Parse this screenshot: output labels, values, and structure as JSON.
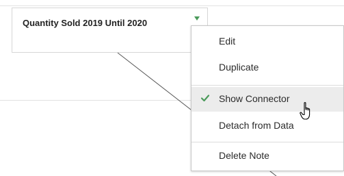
{
  "note": {
    "text": "Quantity Sold 2019 Until 2020",
    "caret_icon": "dropdown-caret-icon",
    "caret_color": "#4a9a5a"
  },
  "context_menu": {
    "items": [
      {
        "label": "Edit"
      },
      {
        "label": "Duplicate"
      },
      {
        "label": "Show Connector",
        "checked": true,
        "hovered": true
      },
      {
        "label": "Detach from Data"
      },
      {
        "label": "Delete Note"
      }
    ],
    "check_icon": "checkmark-icon",
    "check_color": "#4a9a5a"
  },
  "cursor": {
    "icon": "hand-pointer-cursor-icon"
  }
}
